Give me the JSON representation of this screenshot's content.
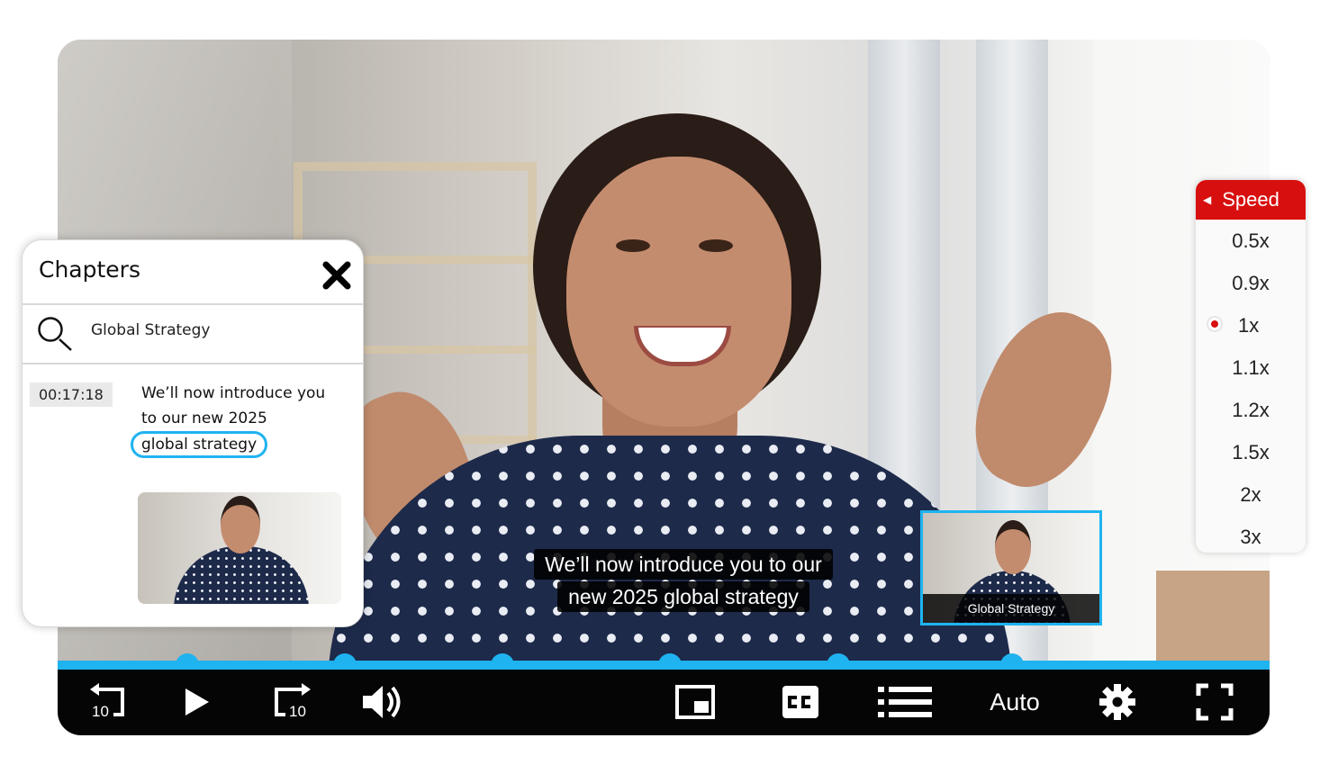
{
  "chapters_panel": {
    "title": "Chapters",
    "search_value": "Global Strategy",
    "entries": [
      {
        "timestamp": "00:17:18",
        "text_before": "We’ll now introduce you to our new 2025",
        "text_highlight": "global strategy"
      }
    ]
  },
  "subtitles": {
    "line1": "We’ll now introduce you to our",
    "line2": "new 2025 global strategy"
  },
  "preview": {
    "label": "Global Strategy"
  },
  "speed_menu": {
    "title": "Speed",
    "options": [
      "0.5x",
      "0.9x",
      "1x",
      "1.1x",
      "1.2x",
      "1.5x",
      "2x",
      "3x"
    ],
    "selected": "1x"
  },
  "controls": {
    "rewind_seconds": "10",
    "forward_seconds": "10",
    "quality": "Auto",
    "icons": [
      "rewind-10-icon",
      "play-icon",
      "forward-10-icon",
      "volume-icon",
      "picture-in-picture-icon",
      "closed-captions-icon",
      "chapters-list-icon",
      "gear-icon",
      "fullscreen-icon"
    ]
  },
  "colors": {
    "accent": "#1fb3f0",
    "speed_header": "#d80f0f",
    "control_bar": "#050505"
  }
}
